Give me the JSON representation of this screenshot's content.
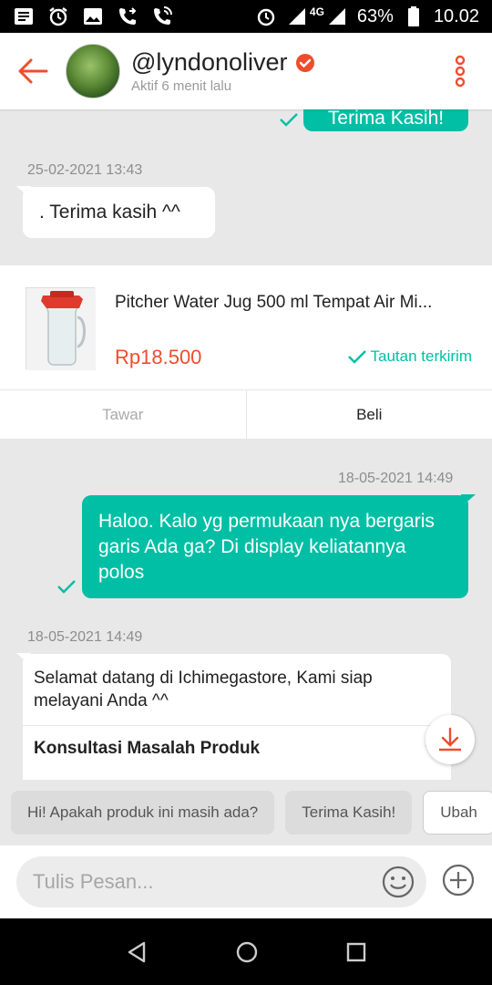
{
  "status_bar": {
    "network": "4G",
    "battery": "63%",
    "time": "10.02"
  },
  "header": {
    "username": "@lyndonoliver",
    "status": "Aktif 6 menit lalu"
  },
  "messages": {
    "top_partial": "Terima Kasih!",
    "ts1": "25-02-2021 13:43",
    "in1": ". Terima kasih ^^",
    "ts2": "18-05-2021 14:49",
    "out2": "Haloo. Kalo yg permukaan nya bergaris garis Ada ga? Di display keliatannya polos",
    "ts3": "18-05-2021 14:49"
  },
  "product": {
    "name": "Pitcher Water Jug 500 ml Tempat Air Mi...",
    "price": "Rp18.500",
    "link_status": "Tautan terkirim",
    "action_tawar": "Tawar",
    "action_beli": "Beli"
  },
  "welcome": {
    "text": "Selamat datang di Ichimegastore, Kami siap melayani Anda ^^",
    "option1": "Konsultasi Masalah Produk"
  },
  "quick_replies": [
    "Hi! Apakah produk ini masih ada?",
    "Terima Kasih!",
    "Ubah"
  ],
  "input": {
    "placeholder": "Tulis Pesan..."
  },
  "colors": {
    "accent": "#ee4d2d",
    "bubble_out": "#00bfa5"
  }
}
